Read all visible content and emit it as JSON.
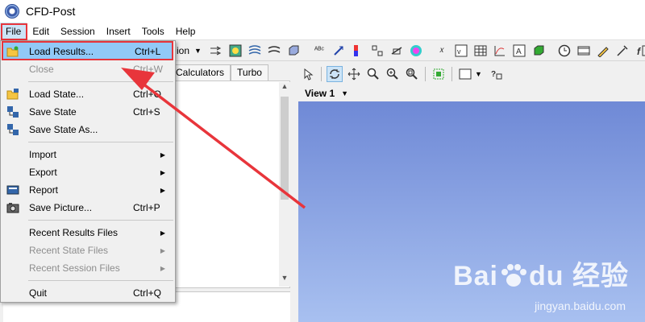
{
  "app": {
    "title": "CFD-Post"
  },
  "menubar": {
    "items": [
      {
        "label": "File",
        "active": true
      },
      {
        "label": "Edit"
      },
      {
        "label": "Session"
      },
      {
        "label": "Insert"
      },
      {
        "label": "Tools"
      },
      {
        "label": "Help"
      }
    ]
  },
  "toolbar": {
    "dropdown_label": "ion"
  },
  "left_panel": {
    "tabs": [
      "Calculators",
      "Turbo"
    ]
  },
  "viewer": {
    "view_label": "View 1"
  },
  "file_menu": {
    "items": [
      {
        "label": "Load Results...",
        "shortcut": "Ctrl+L",
        "icon": "folder-open-icon",
        "highlighted": true
      },
      {
        "label": "Close",
        "shortcut": "Ctrl+W",
        "disabled": true
      },
      {
        "label": "Load State...",
        "shortcut": "Ctrl+O",
        "icon": "folder-state-icon"
      },
      {
        "label": "Save State",
        "shortcut": "Ctrl+S",
        "icon": "save-state-icon"
      },
      {
        "label": "Save State As...",
        "icon": "save-state-as-icon"
      },
      {
        "label": "Import",
        "submenu": true
      },
      {
        "label": "Export",
        "submenu": true
      },
      {
        "label": "Report",
        "submenu": true,
        "icon": "report-icon"
      },
      {
        "label": "Save Picture...",
        "shortcut": "Ctrl+P",
        "icon": "camera-icon"
      },
      {
        "label": "Recent Results Files",
        "submenu": true
      },
      {
        "label": "Recent State Files",
        "submenu": true,
        "disabled": true
      },
      {
        "label": "Recent Session Files",
        "submenu": true,
        "disabled": true
      },
      {
        "label": "Quit",
        "shortcut": "Ctrl+Q"
      }
    ]
  },
  "watermark": {
    "brand": "Bai",
    "brand2": "du",
    "cn": "经验",
    "url": "jingyan.baidu.com"
  },
  "colors": {
    "highlight": "#91c9f7",
    "annotation_red": "#e8353b",
    "viewport_top": "#6f89d6",
    "viewport_bottom": "#a8c0f0"
  }
}
